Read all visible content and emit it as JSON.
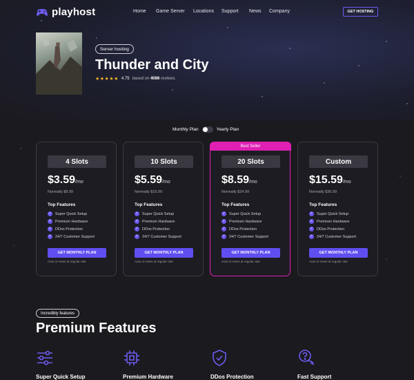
{
  "brand": {
    "name": "playhost"
  },
  "nav": {
    "items": [
      "Home",
      "Game Server",
      "Locations",
      "Support",
      "News",
      "Company"
    ],
    "cta": "GET HOSTING"
  },
  "hero": {
    "badge": "Server hosting",
    "title": "Thunder and City",
    "rating_value": "4.75",
    "rating_prefix": "based on",
    "rating_count": "4086",
    "rating_suffix": "reviews.",
    "stars": "★★★★★"
  },
  "toggle": {
    "left_label": "Monthly Plan",
    "right_label": "Yearly Plan"
  },
  "plans": [
    {
      "slots": "4 Slots",
      "price": "$3.59",
      "per": "/mo",
      "normally": "Normally $8.99",
      "badge": ""
    },
    {
      "slots": "10 Slots",
      "price": "$5.59",
      "per": "/mo",
      "normally": "Normally $15.99",
      "badge": ""
    },
    {
      "slots": "20 Slots",
      "price": "$8.59",
      "per": "/mo",
      "normally": "Normally $24.99",
      "badge": "Best Seller"
    },
    {
      "slots": "Custom",
      "price": "$15.59",
      "per": "/mo",
      "normally": "Normally $36.99",
      "badge": ""
    }
  ],
  "plan_common": {
    "features_title": "Top Features",
    "features": [
      "Super Quick Setup",
      "Premium Hardware",
      "DDos Protection",
      "24/7 Customer Support"
    ],
    "button": "GET MONTHLY PLAN",
    "renew": "Auto re-news at regular rate"
  },
  "premium": {
    "pill": "Incredibly features",
    "title": "Premium Features",
    "items": [
      "Super Quick Setup",
      "Premium Hardware",
      "DDos Protection",
      "Fast Support"
    ]
  },
  "colors": {
    "accent": "#5f4ef0",
    "featured": "#e01fb3",
    "background": "#1b1a1f",
    "star": "#f5b52a"
  }
}
